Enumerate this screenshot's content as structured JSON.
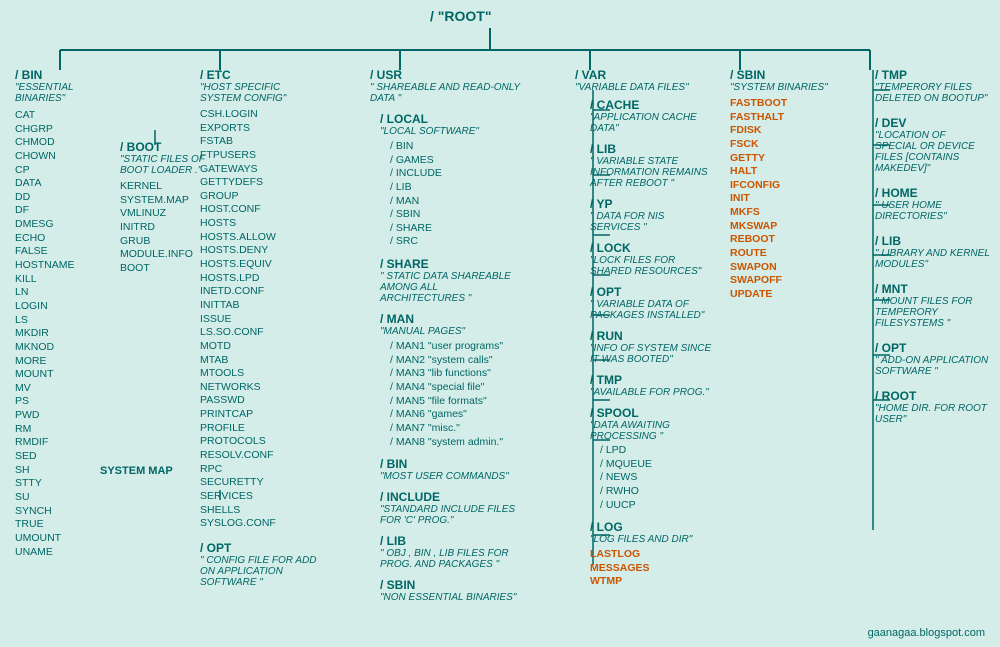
{
  "root": {
    "label": "/   \"ROOT\""
  },
  "bin": {
    "title": "/ BIN",
    "desc": "\"ESSENTIAL BINARIES\"",
    "files": [
      "CAT",
      "CHGRP",
      "CHMOD",
      "CHOWN",
      "CP",
      "DATA",
      "DD",
      "DF",
      "DMESG",
      "ECHO",
      "FALSE",
      "HOSTNAME",
      "KILL",
      "LN",
      "LOGIN",
      "LS",
      "MKDIR",
      "MKNOD",
      "MORE",
      "MOUNT",
      "MV",
      "PS",
      "PWD",
      "RM",
      "RMDIF",
      "SED",
      "SH",
      "STTY",
      "SU",
      "SYNCH",
      "TRUE",
      "UMOUNT",
      "UNAME"
    ]
  },
  "etc": {
    "title": "/ ETC",
    "desc": "\"HOST SPECIFIC SYSTEM CONFIG\"",
    "files": [
      "CSH.LOGIN",
      "EXPORTS",
      "FSTAB",
      "FTPUSERS",
      "GATEWAYS",
      "GETTYDEFS",
      "GROUP",
      "HOST.CONF",
      "HOSTS",
      "HOSTS.ALLOW",
      "HOSTS.DENY",
      "HOSTS.EQUIV",
      "HOSTS.LPD",
      "INETD.CONF",
      "INITTAB",
      "ISSUE",
      "LS.SO.CONF",
      "MOTD",
      "MTAB",
      "MTOOLS",
      "NETWORKS",
      "PASSWD",
      "PRINTCAP",
      "PROFILE",
      "PROTOCOLS",
      "RESOLV.CONF",
      "RPC",
      "SECURETTY",
      "SERVICES",
      "SHELLS",
      "SYSLOG.CONF"
    ],
    "opt": {
      "title": "/ OPT",
      "desc": "\" CONFIG FILE FOR ADD ON APPLICATION SOFTWARE \""
    }
  },
  "boot": {
    "title": "/ BOOT",
    "desc": "\"STATIC FILES OF BOOT LOADER .\"",
    "files": [
      "KERNEL",
      "SYSTEM.MAP",
      "VMLINUZ",
      "INITRD",
      "GRUB",
      "MODULE.INFO",
      "BOOT"
    ]
  },
  "usr": {
    "title": "/ USR",
    "desc": "\" SHAREABLE AND READ-ONLY DATA \"",
    "local": {
      "title": "/ LOCAL",
      "desc": "\"LOCAL SOFTWARE\"",
      "subdirs": [
        "/ BIN",
        "/ GAMES",
        "/ INCLUDE",
        "/ LIB",
        "/ MAN",
        "/ SBIN",
        "/ SHARE",
        "/ SRC"
      ]
    },
    "share": {
      "title": "/ SHARE",
      "desc": "\" STATIC DATA SHAREABLE AMONG ALL ARCHITECTURES \""
    },
    "man": {
      "title": "/ MAN",
      "desc": "\"MANUAL PAGES\"",
      "subdirs": [
        "/ MAN1 \"user programs\"",
        "/ MAN2 \"system calls\"",
        "/ MAN3 \"lib functions\"",
        "/ MAN4 \"special file\"",
        "/ MAN5 \"file formats\"",
        "/ MAN6 \"games\"",
        "/ MAN7 \"misc.\"",
        "/ MAN8 \"system admin.\""
      ]
    },
    "bin": {
      "title": "/ BIN",
      "desc": "\"MOST USER COMMANDS\""
    },
    "include": {
      "title": "/ INCLUDE",
      "desc": "\"STANDARD INCLUDE FILES FOR 'C' PROG.\""
    },
    "lib": {
      "title": "/ LIB",
      "desc": "\" OBJ , BIN , LIB FILES FOR PROG. AND PACKAGES \""
    },
    "sbin": {
      "title": "/ SBIN",
      "desc": "\"NON ESSENTIAL BINARIES\""
    }
  },
  "var": {
    "title": "/ VAR",
    "desc": "\"VARIABLE DATA FILES\"",
    "cache": {
      "title": "/ CACHE",
      "desc": "\"APPLICATION CACHE DATA\""
    },
    "lib": {
      "title": "/ LIB",
      "desc": "\" VARIABLE STATE INFORMATION REMAINS AFTER REBOOT \""
    },
    "yp": {
      "title": "/ YP",
      "desc": "\" DATA FOR NIS SERVICES \""
    },
    "lock": {
      "title": "/ LOCK",
      "desc": "\"LOCK FILES FOR SHARED RESOURCES\""
    },
    "opt": {
      "title": "/ OPT",
      "desc": "\" VARIABLE DATA OF PACKAGES INSTALLED\""
    },
    "run": {
      "title": "/ RUN",
      "desc": "\"INFO OF SYSTEM SINCE IT WAS BOOTED\""
    },
    "tmp": {
      "title": "/ TMP",
      "desc": "\"AVAILABLE FOR PROG.\""
    },
    "spool": {
      "title": "/ SPOOL",
      "desc": "\"DATA AWAITING PROCESSING \"",
      "subdirs": [
        "/ LPD",
        "/ MQUEUE",
        "/ NEWS",
        "/ RWHO",
        "/ UUCP"
      ]
    },
    "log": {
      "title": "/ LOG",
      "desc": "\"LOG FILES AND DIR\"",
      "files_orange": [
        "LASTLOG",
        "MESSAGES",
        "WTMP"
      ]
    }
  },
  "sbin": {
    "title": "/ SBIN",
    "desc": "\"SYSTEM BINARIES\"",
    "files_orange": [
      "FASTBOOT",
      "FASTHALT",
      "FDISK",
      "FSCK",
      "GETTY",
      "HALT",
      "IFCONFIG",
      "INIT",
      "MKFS",
      "MKSWAP",
      "REBOOT",
      "ROUTE",
      "SWAPON",
      "SWAPOFF",
      "UPDATE"
    ]
  },
  "right": {
    "tmp": {
      "title": "/ TMP",
      "desc": "\"TEMPERORY FILES DELETED ON BOOTUP\""
    },
    "dev": {
      "title": "/ DEV",
      "desc": "\"LOCATION OF SPECIAL OR DEVICE FILES [CONTAINS MAKEDEV]\""
    },
    "home": {
      "title": "/ HOME",
      "desc": "\" USER HOME DIRECTORIES\""
    },
    "lib": {
      "title": "/ LIB",
      "desc": "\"  LIBRARY AND KERNEL MODULES\""
    },
    "mnt": {
      "title": "/ MNT",
      "desc": "\"  MOUNT FILES FOR TEMPERORY FILESYSTEMS \""
    },
    "opt": {
      "title": "/ OPT",
      "desc": "\" ADD-ON APPLICATION SOFTWARE \""
    },
    "root": {
      "title": "/ ROOT",
      "desc": "\"HOME DIR. FOR ROOT USER\""
    }
  },
  "watermark": "gaanagaa.blogspot.com",
  "system_map_label": "SYSTEM MAP"
}
